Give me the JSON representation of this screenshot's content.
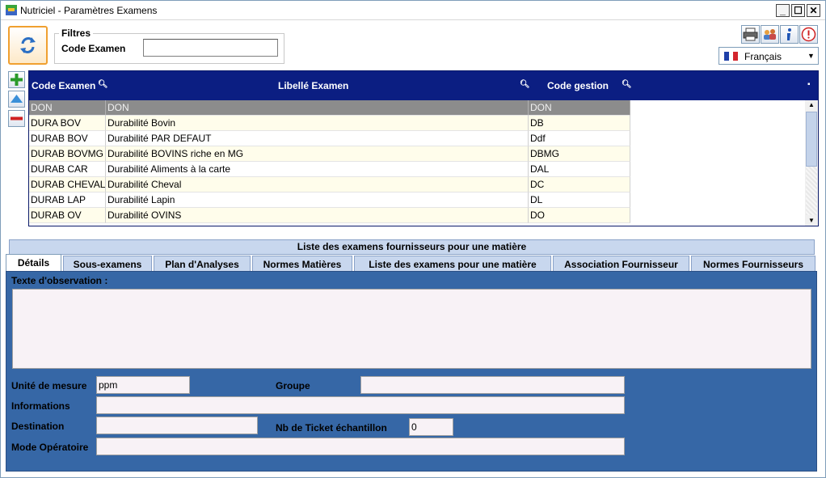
{
  "window": {
    "title": "Nutriciel - Paramètres Examens",
    "minimize_label": "_",
    "maximize_label": "☐",
    "close_label": "✕"
  },
  "filters": {
    "legend": "Filtres",
    "code_label": "Code Examen",
    "code_value": ""
  },
  "language": {
    "selected": "Français"
  },
  "grid": {
    "columns": [
      "Code Examen",
      "Libellé Examen",
      "Code gestion"
    ],
    "filter_row": [
      "DON",
      "DON",
      "DON"
    ],
    "rows": [
      [
        "DURA BOV",
        "Durabilité Bovin",
        "DB"
      ],
      [
        "DURAB BOV",
        "Durabilité PAR DEFAUT",
        "Ddf"
      ],
      [
        "DURAB BOVMG",
        "Durabilité BOVINS riche en MG",
        "DBMG"
      ],
      [
        "DURAB CAR",
        "Durabilité Aliments à la carte",
        "DAL"
      ],
      [
        "DURAB CHEVAL",
        "Durabilité Cheval",
        "DC"
      ],
      [
        "DURAB LAP",
        "Durabilité Lapin",
        "DL"
      ],
      [
        "DURAB OV",
        "Durabilité OVINS",
        "DO"
      ]
    ]
  },
  "panel": {
    "title": "Liste des examens fournisseurs pour une matière",
    "tabs": [
      "Détails",
      "Sous-examens",
      "Plan d'Analyses",
      "Normes Matières",
      "Liste des examens pour une matière",
      "Association Fournisseur",
      "Normes Fournisseurs"
    ]
  },
  "details": {
    "observation_label": "Texte d'observation :",
    "observation_value": "",
    "unite_label": "Unité de mesure",
    "unite_value": "ppm",
    "groupe_label": "Groupe",
    "groupe_value": "",
    "informations_label": "Informations",
    "informations_value": "",
    "destination_label": "Destination",
    "destination_value": "",
    "ticket_label": "Nb de Ticket échantillon",
    "ticket_value": "0",
    "mode_label": "Mode Opératoire",
    "mode_value": ""
  },
  "colors": {
    "grid_header": "#0b1e82",
    "tab_body": "#3667a6",
    "tab_inactive": "#c8d7ee",
    "row_alt": "#fffdeb",
    "filter_row": "#8c8c8c",
    "refresh_border": "#f0a030"
  },
  "icons": {
    "app": "app-logo-icon",
    "refresh": "refresh-icon",
    "print": "printer-icon",
    "people": "users-icon",
    "info": "info-icon",
    "stop": "power-icon",
    "add": "plus-icon",
    "up": "arrow-up-icon",
    "remove": "minus-icon",
    "search": "magnifier-icon"
  }
}
